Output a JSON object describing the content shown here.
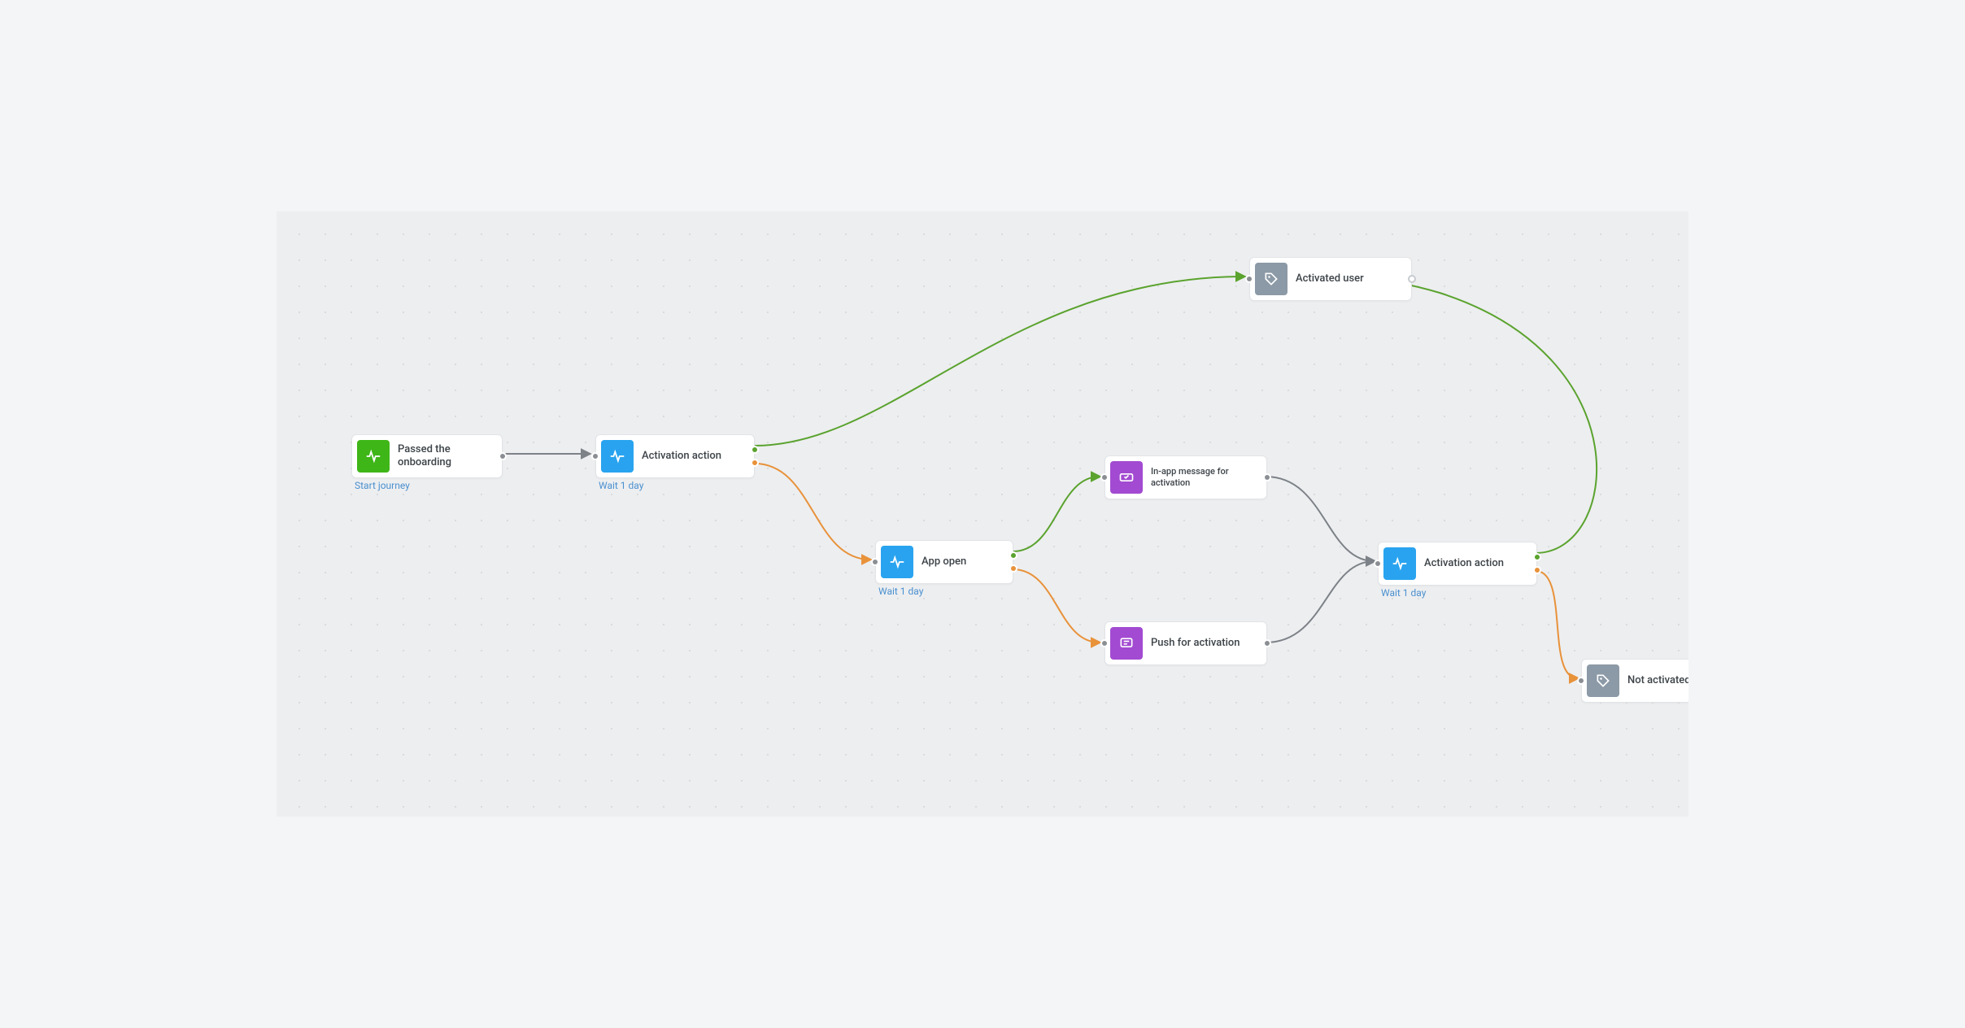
{
  "colors": {
    "edge_grey": "#7d8288",
    "edge_green": "#5aa32e",
    "edge_orange": "#e8923a"
  },
  "nodes": {
    "start": {
      "label": "Passed the onboarding",
      "caption": "Start journey",
      "icon": "pulse",
      "icon_color": "green"
    },
    "activation1": {
      "label": "Activation action",
      "caption": "Wait 1 day",
      "icon": "pulse",
      "icon_color": "blue"
    },
    "app_open": {
      "label": "App open",
      "caption": "Wait 1 day",
      "icon": "pulse",
      "icon_color": "blue"
    },
    "inapp": {
      "label": "In-app message for activation",
      "icon": "ticket",
      "icon_color": "purple"
    },
    "push": {
      "label": "Push for activation",
      "icon": "message",
      "icon_color": "purple"
    },
    "activation2": {
      "label": "Activation action",
      "caption": "Wait 1 day",
      "icon": "pulse",
      "icon_color": "blue"
    },
    "activated": {
      "label": "Activated user",
      "icon": "tag",
      "icon_color": "grey"
    },
    "not_activated": {
      "label": "Not activated",
      "icon": "tag",
      "icon_color": "grey"
    }
  }
}
